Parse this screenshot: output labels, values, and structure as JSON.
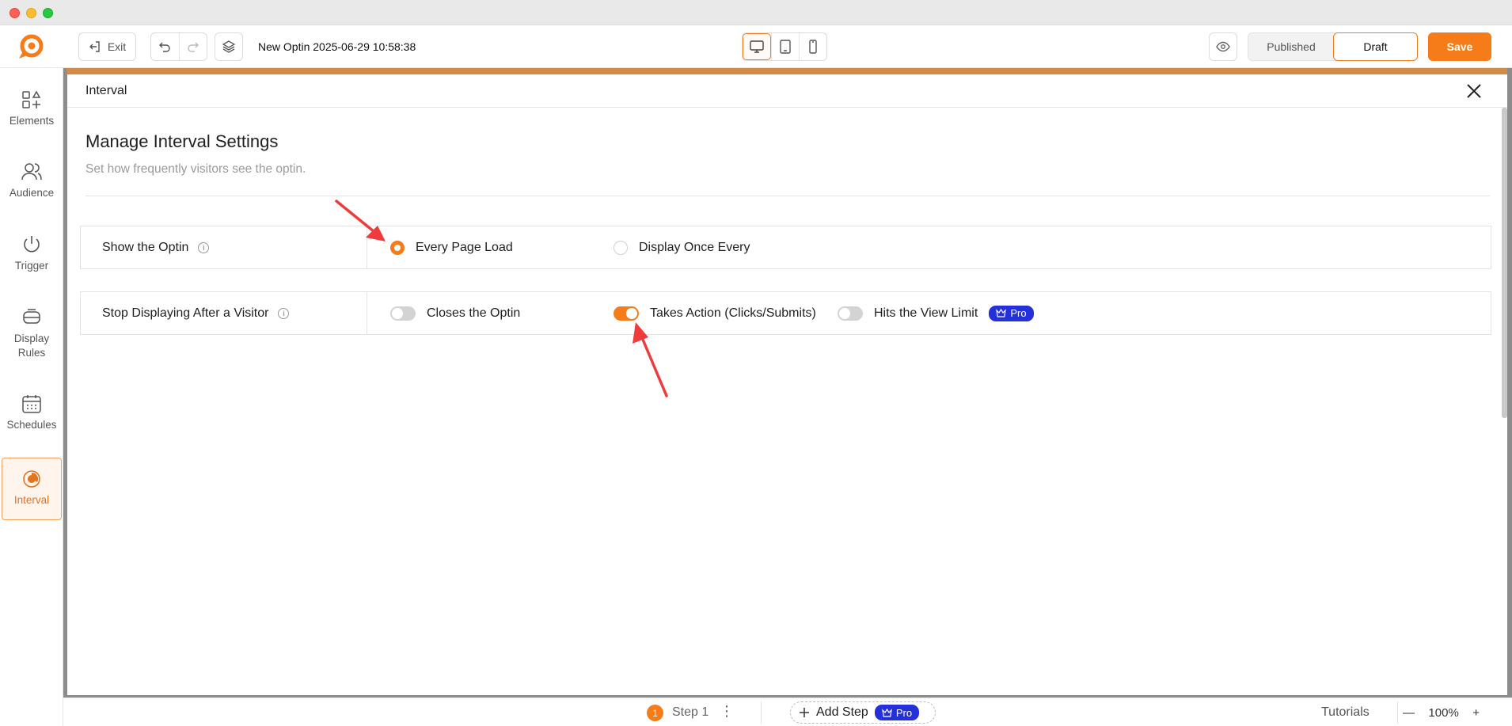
{
  "header": {
    "exit_label": "Exit",
    "doc_title": "New Optin 2025-06-29 10:58:38",
    "published_label": "Published",
    "draft_label": "Draft",
    "save_label": "Save"
  },
  "sidebar": {
    "items": [
      {
        "label": "Elements",
        "icon": "elements-icon"
      },
      {
        "label": "Audience",
        "icon": "audience-icon"
      },
      {
        "label": "Trigger",
        "icon": "power-icon"
      },
      {
        "label": "Display\nRules",
        "icon": "display-rules-icon"
      },
      {
        "label": "Schedules",
        "icon": "calendar-icon"
      },
      {
        "label": "Interval",
        "icon": "interval-icon",
        "active": true
      }
    ]
  },
  "panel": {
    "title": "Interval",
    "heading": "Manage Interval Settings",
    "subheading": "Set how frequently visitors see the optin."
  },
  "show_optin": {
    "label": "Show the Optin",
    "options": [
      {
        "label": "Every Page Load",
        "selected": true
      },
      {
        "label": "Display Once Every",
        "selected": false
      }
    ]
  },
  "stop_displaying": {
    "label": "Stop Displaying After a Visitor",
    "options": [
      {
        "label": "Closes the Optin",
        "on": false
      },
      {
        "label": "Takes Action (Clicks/Submits)",
        "on": true
      },
      {
        "label": "Hits the View Limit",
        "on": false,
        "badge": "Pro"
      }
    ]
  },
  "footer": {
    "step_number": "1",
    "step_label": "Step 1",
    "add_step_label": "Add Step",
    "add_step_badge": "Pro",
    "tutorials_label": "Tutorials",
    "zoom_value": "100%"
  },
  "colors": {
    "accent": "#f57c18",
    "pro_badge": "#2531d8",
    "annotation_arrow": "#ef3b3b"
  }
}
